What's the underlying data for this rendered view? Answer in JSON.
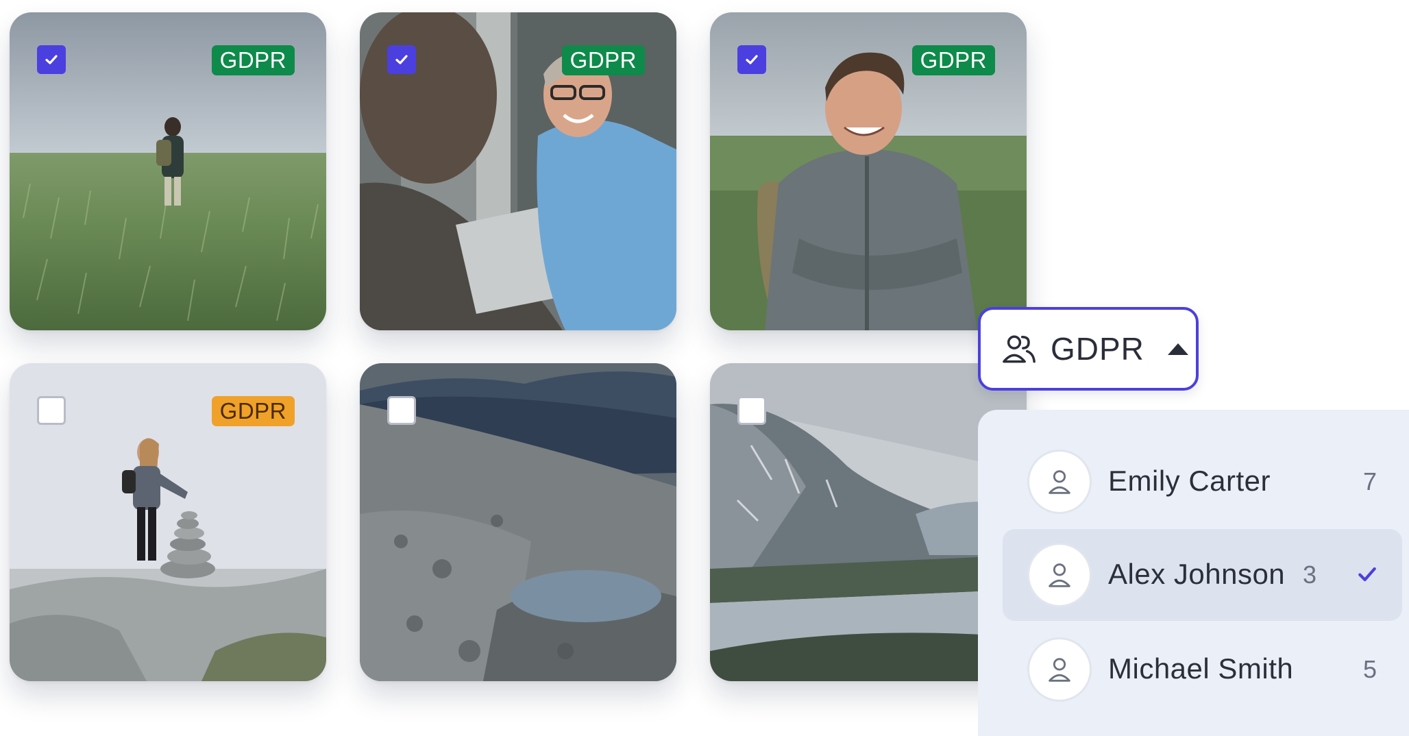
{
  "tiles": [
    {
      "checked": true,
      "badge": "GDPR",
      "badge_color": "#0E8A4A"
    },
    {
      "checked": true,
      "badge": "GDPR",
      "badge_color": "#0E8A4A"
    },
    {
      "checked": true,
      "badge": "GDPR",
      "badge_color": "#0E8A4A"
    },
    {
      "checked": false,
      "badge": "GDPR",
      "badge_color": "#F0A12A"
    },
    {
      "checked": false,
      "badge": null
    },
    {
      "checked": false,
      "badge": null
    }
  ],
  "filter": {
    "label": "GDPR",
    "icon": "people-icon",
    "caret": "caret-up-icon"
  },
  "dropdown": {
    "items": [
      {
        "name": "Emily Carter",
        "count": "7",
        "selected": false
      },
      {
        "name": "Alex Johnson",
        "count": "3",
        "selected": true
      },
      {
        "name": "Michael Smith",
        "count": "5",
        "selected": false
      }
    ]
  },
  "colors": {
    "accent": "#4B3FE0",
    "gdpr_ok": "#0E8A4A",
    "gdpr_warning": "#F0A12A"
  }
}
